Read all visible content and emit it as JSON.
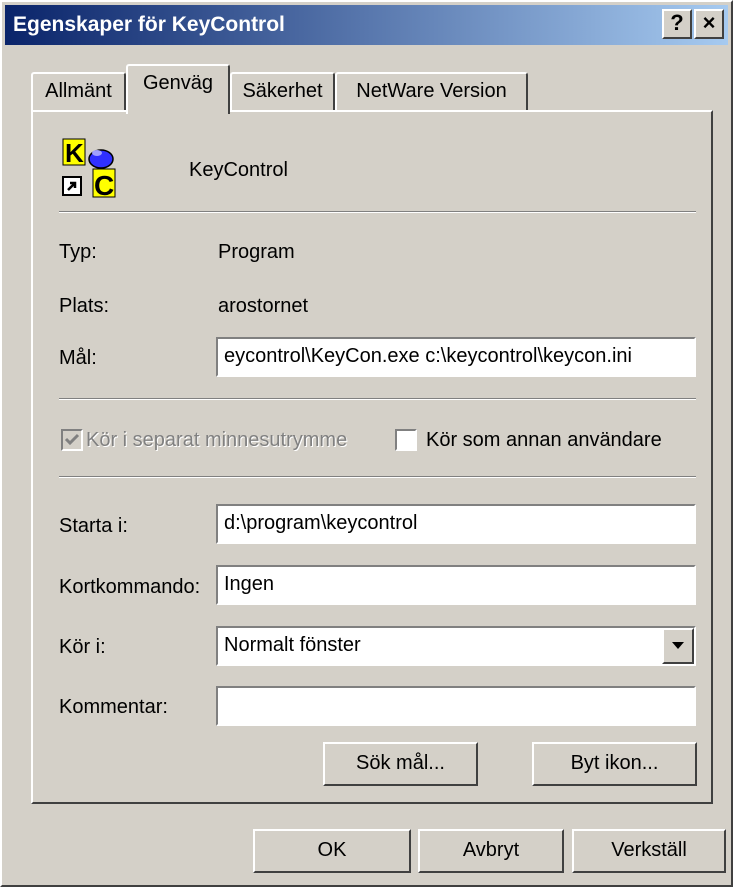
{
  "window": {
    "title": "Egenskaper för KeyControl",
    "help_button": "?",
    "close_button": "×"
  },
  "tabs": [
    {
      "label": "Allmänt"
    },
    {
      "label": "Genväg",
      "active": true
    },
    {
      "label": "Säkerhet"
    },
    {
      "label": "NetWare Version"
    }
  ],
  "shortcut": {
    "name": "KeyControl",
    "icon": "keycontrol-app-icon"
  },
  "fields": {
    "type_label": "Typ:",
    "type_value": "Program",
    "location_label": "Plats:",
    "location_value": "arostornet",
    "target_label": "Mål:",
    "target_value": "eycontrol\\KeyCon.exe  c:\\keycontrol\\keycon.ini",
    "start_in_label": "Starta i:",
    "start_in_value": "d:\\program\\keycontrol",
    "shortcut_key_label": "Kortkommando:",
    "shortcut_key_value": "Ingen",
    "run_label": "Kör i:",
    "run_value": "Normalt fönster",
    "comment_label": "Kommentar:",
    "comment_value": ""
  },
  "checkboxes": {
    "separate_memory": {
      "label": "Kör i separat minnesutrymme",
      "checked": true,
      "disabled": true
    },
    "run_as_other": {
      "label": "Kör som annan användare",
      "checked": false
    }
  },
  "buttons": {
    "find_target": "Sök mål...",
    "change_icon": "Byt ikon...",
    "ok": "OK",
    "cancel": "Avbryt",
    "apply": "Verkställ"
  }
}
